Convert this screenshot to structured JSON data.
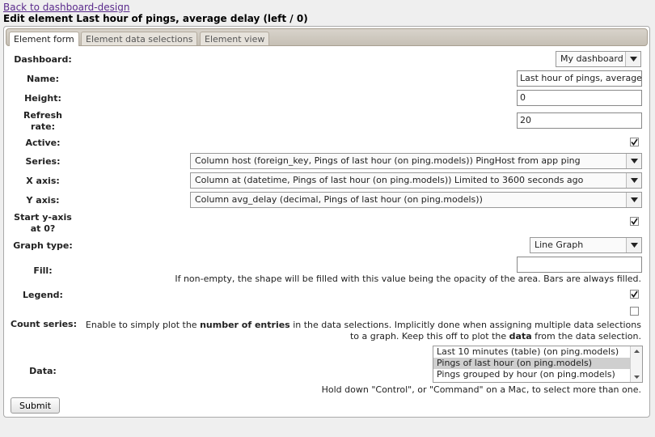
{
  "nav": {
    "back_link": "Back to dashboard-design"
  },
  "page": {
    "title": "Edit element Last hour of pings, average delay (left / 0)"
  },
  "tabs": [
    {
      "label": "Element form",
      "active": true
    },
    {
      "label": "Element data selections",
      "active": false
    },
    {
      "label": "Element view",
      "active": false
    }
  ],
  "form": {
    "dashboard": {
      "label": "Dashboard:",
      "value": "My dashboard"
    },
    "name": {
      "label": "Name:",
      "value": "Last hour of pings, average delay"
    },
    "height": {
      "label": "Height:",
      "value": "0"
    },
    "refresh_rate": {
      "label_line1": "Refresh",
      "label_line2": "rate:",
      "value": "20"
    },
    "active": {
      "label": "Active:",
      "checked": true
    },
    "series": {
      "label": "Series:",
      "value": "Column host (foreign_key, Pings of last hour (on ping.models)) PingHost from app ping"
    },
    "x_axis": {
      "label": "X axis:",
      "value": "Column at (datetime, Pings of last hour (on ping.models)) Limited to 3600 seconds ago"
    },
    "y_axis": {
      "label": "Y axis:",
      "value": "Column avg_delay (decimal, Pings of last hour (on ping.models))"
    },
    "start_y_zero": {
      "label_line1": "Start y-axis",
      "label_line2": "at 0?",
      "checked": true
    },
    "graph_type": {
      "label": "Graph type:",
      "value": "Line Graph"
    },
    "fill": {
      "label": "Fill:",
      "value": "",
      "help": "If non-empty, the shape will be filled with this value being the opacity of the area. Bars are always filled."
    },
    "legend": {
      "label": "Legend:",
      "checked": true
    },
    "count_series": {
      "label": "Count series:",
      "checked": false,
      "help_pre": "Enable to simply plot the ",
      "help_bold1": "number of entries",
      "help_mid": " in the data selections. Implicitly done when assigning multiple data selections",
      "help_line2_pre": "to a graph. Keep this off to plot the ",
      "help_bold2": "data",
      "help_line2_post": " from the data selection."
    },
    "data": {
      "label": "Data:",
      "options": [
        {
          "label": "Last 10 minutes (table) (on ping.models)",
          "selected": false
        },
        {
          "label": "Pings of last hour (on ping.models)",
          "selected": true
        },
        {
          "label": "Pings grouped by hour (on ping.models)",
          "selected": false
        }
      ],
      "help": "Hold down \"Control\", or \"Command\" on a Mac, to select more than one."
    },
    "submit_label": "Submit"
  }
}
